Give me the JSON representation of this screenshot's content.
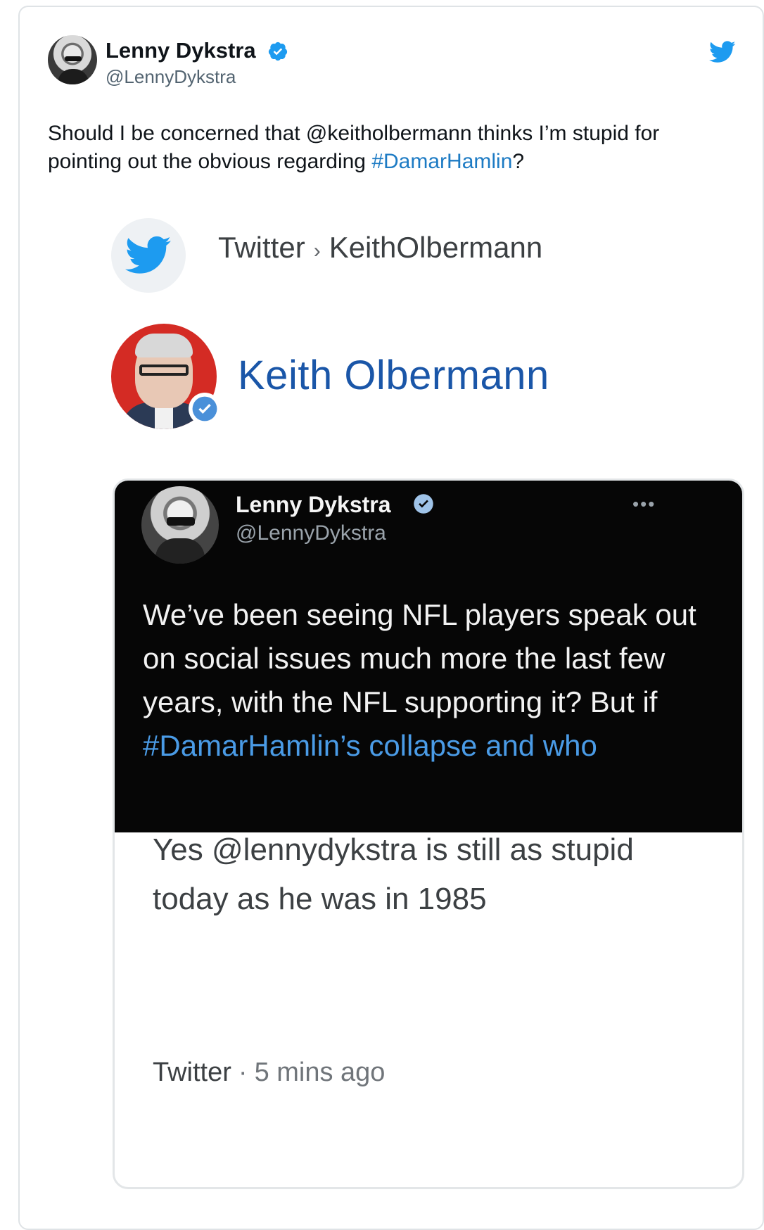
{
  "tweet": {
    "author_name": "Lenny Dykstra",
    "author_handle": "@LennyDykstra",
    "text_part1": "Should I be concerned that @keitholbermann thinks I’m stupid for pointing out the obvious regarding ",
    "hashtag": "#DamarHamlin",
    "text_part2": "?"
  },
  "embed": {
    "breadcrumb_site": "Twitter",
    "breadcrumb_sep": "›",
    "breadcrumb_page": "KeithOlbermann",
    "profile_name": "Keith Olbermann",
    "quoted": {
      "author_name": "Lenny Dykstra",
      "author_handle": "@LennyDykstra",
      "more": "•••",
      "text": "We’ve been seeing NFL players speak out on social issues much more the last few years, with the NFL supporting it? But if ",
      "hashtag": "#DamarHamlin’s collapse and who"
    },
    "reply_text": "Yes @lennydykstra is still as stupid today as he was in 1985",
    "footer_source": "Twitter",
    "footer_dot": "·",
    "footer_time": "5 mins ago"
  },
  "colors": {
    "link": "#1d7bc4",
    "twitter_blue": "#1d9bf0",
    "name_blue": "#1a56a8"
  },
  "icons": [
    "verified-badge-icon",
    "twitter-bird-icon"
  ]
}
